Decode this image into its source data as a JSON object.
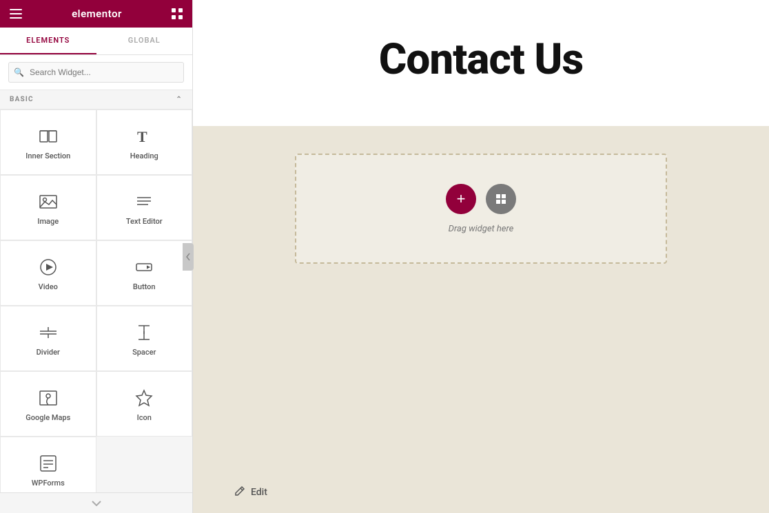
{
  "header": {
    "logo": "elementor",
    "hamburger_icon": "hamburger",
    "grid_icon": "grid"
  },
  "tabs": [
    {
      "label": "ELEMENTS",
      "active": true
    },
    {
      "label": "GLOBAL",
      "active": false
    }
  ],
  "search": {
    "placeholder": "Search Widget..."
  },
  "section_label": "BASIC",
  "widgets": [
    {
      "id": "inner-section",
      "label": "Inner Section",
      "icon": "inner-section-icon"
    },
    {
      "id": "heading",
      "label": "Heading",
      "icon": "heading-icon"
    },
    {
      "id": "image",
      "label": "Image",
      "icon": "image-icon"
    },
    {
      "id": "text-editor",
      "label": "Text Editor",
      "icon": "text-editor-icon"
    },
    {
      "id": "video",
      "label": "Video",
      "icon": "video-icon"
    },
    {
      "id": "button",
      "label": "Button",
      "icon": "button-icon"
    },
    {
      "id": "divider",
      "label": "Divider",
      "icon": "divider-icon"
    },
    {
      "id": "spacer",
      "label": "Spacer",
      "icon": "spacer-icon"
    },
    {
      "id": "google-maps",
      "label": "Google Maps",
      "icon": "google-maps-icon"
    },
    {
      "id": "icon",
      "label": "Icon",
      "icon": "icon-icon"
    },
    {
      "id": "wpforms",
      "label": "WPForms",
      "icon": "wpforms-icon"
    }
  ],
  "canvas": {
    "contact_title": "Contact Us",
    "drop_label": "Drag widget here",
    "add_button_label": "+",
    "edit_label": "Edit"
  },
  "colors": {
    "brand": "#92003b",
    "panel_bg": "#f5f5f5",
    "canvas_bg": "#eae5d8"
  }
}
